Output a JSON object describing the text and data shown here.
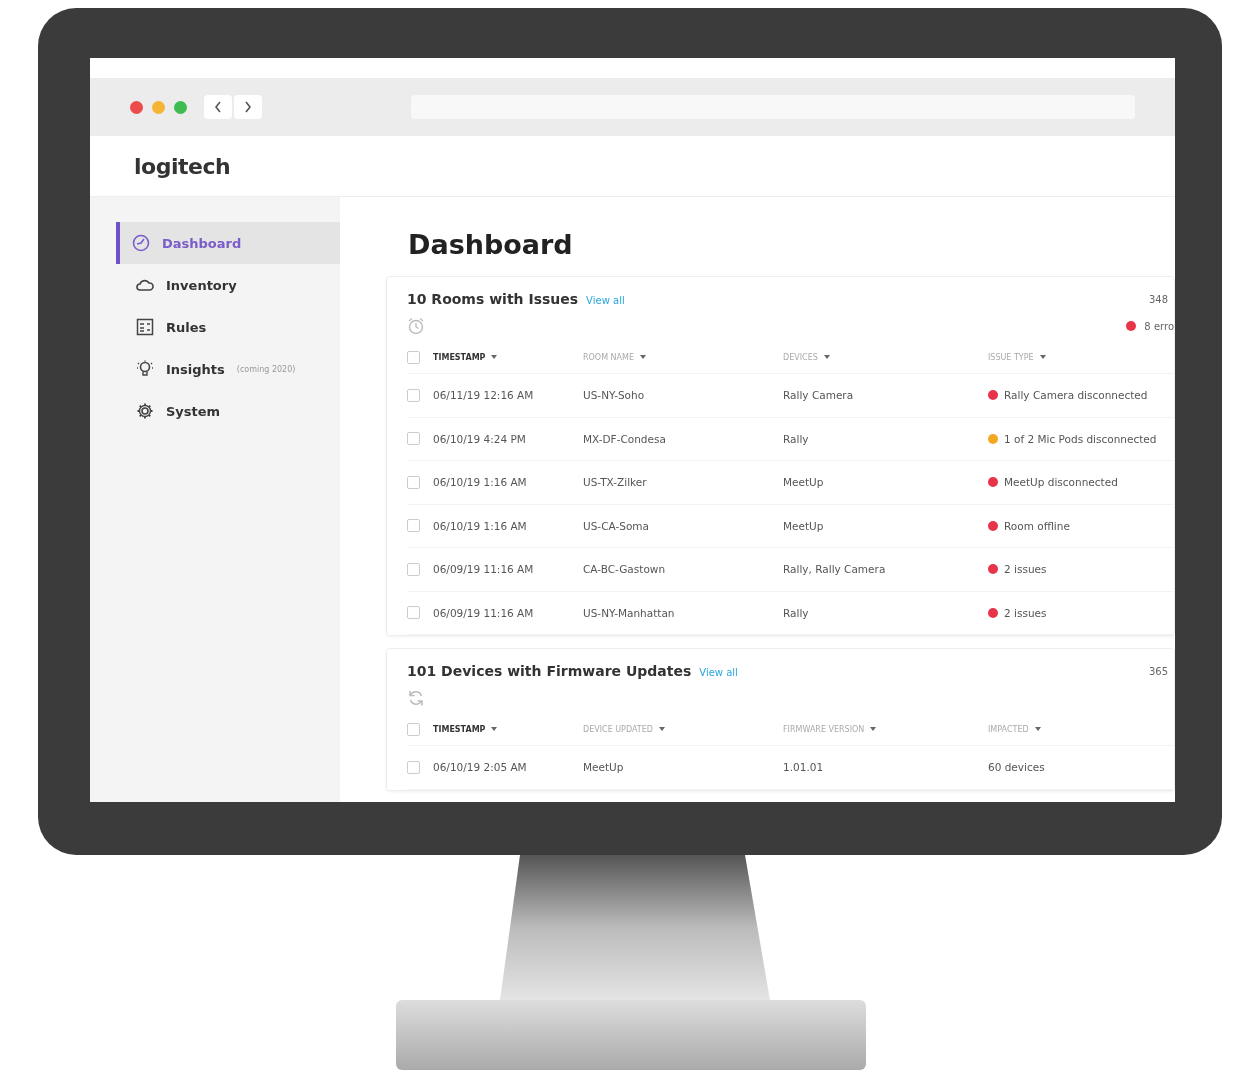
{
  "logo": "logitech",
  "sidebar": {
    "items": [
      {
        "label": "Dashboard",
        "selected": true
      },
      {
        "label": "Inventory",
        "selected": false
      },
      {
        "label": "Rules",
        "selected": false
      },
      {
        "label": "Insights",
        "note": "(coming 2020)",
        "selected": false
      },
      {
        "label": "System",
        "selected": false
      }
    ]
  },
  "page_title": "Dashboard",
  "cards": [
    {
      "title": "10 Rooms with Issues",
      "link": "View all",
      "count": "348",
      "summary": {
        "text": "8 erro",
        "color": "#e8344a"
      },
      "columns": [
        {
          "label": "TIMESTAMP",
          "strong": true
        },
        {
          "label": "ROOM NAME",
          "strong": false
        },
        {
          "label": "DEVICES",
          "strong": false
        },
        {
          "label": "ISSUE TYPE",
          "strong": false
        }
      ],
      "header_checked": false,
      "rows": [
        {
          "checked": false,
          "cells": [
            "06/11/19 12:16 AM",
            "US-NY-Soho",
            "Rally Camera",
            "Rally Camera disconnected"
          ],
          "color": "#e8344a"
        },
        {
          "checked": false,
          "cells": [
            "06/10/19 4:24 PM",
            "MX-DF-Condesa",
            "Rally",
            "1 of 2 Mic Pods disconnected"
          ],
          "color": "#f5a623"
        },
        {
          "checked": false,
          "cells": [
            "06/10/19 1:16 AM",
            "US-TX-Zilker",
            "MeetUp",
            "MeetUp disconnected"
          ],
          "color": "#e8344a"
        },
        {
          "checked": false,
          "cells": [
            "06/10/19 1:16 AM",
            "US-CA-Soma",
            "MeetUp",
            "Room offline"
          ],
          "color": "#e8344a"
        },
        {
          "checked": false,
          "cells": [
            "06/09/19 11:16 AM",
            "CA-BC-Gastown",
            "Rally, Rally Camera",
            "2 issues"
          ],
          "color": "#e8344a"
        },
        {
          "checked": false,
          "cells": [
            "06/09/19 11:16 AM",
            "US-NY-Manhattan",
            "Rally",
            "2 issues"
          ],
          "color": "#e8344a"
        }
      ]
    },
    {
      "title": "101 Devices with Firmware Updates",
      "link": "View all",
      "count": "365",
      "columns": [
        {
          "label": "TIMESTAMP",
          "strong": true
        },
        {
          "label": "DEVICE UPDATED",
          "strong": false
        },
        {
          "label": "FIRMWARE VERSION",
          "strong": false
        },
        {
          "label": "IMPACTED",
          "strong": false
        }
      ],
      "header_checked": false,
      "rows": [
        {
          "checked": false,
          "cells": [
            "06/10/19 2:05 AM",
            "MeetUp",
            "1.01.01",
            "60 devices"
          ]
        }
      ]
    }
  ]
}
